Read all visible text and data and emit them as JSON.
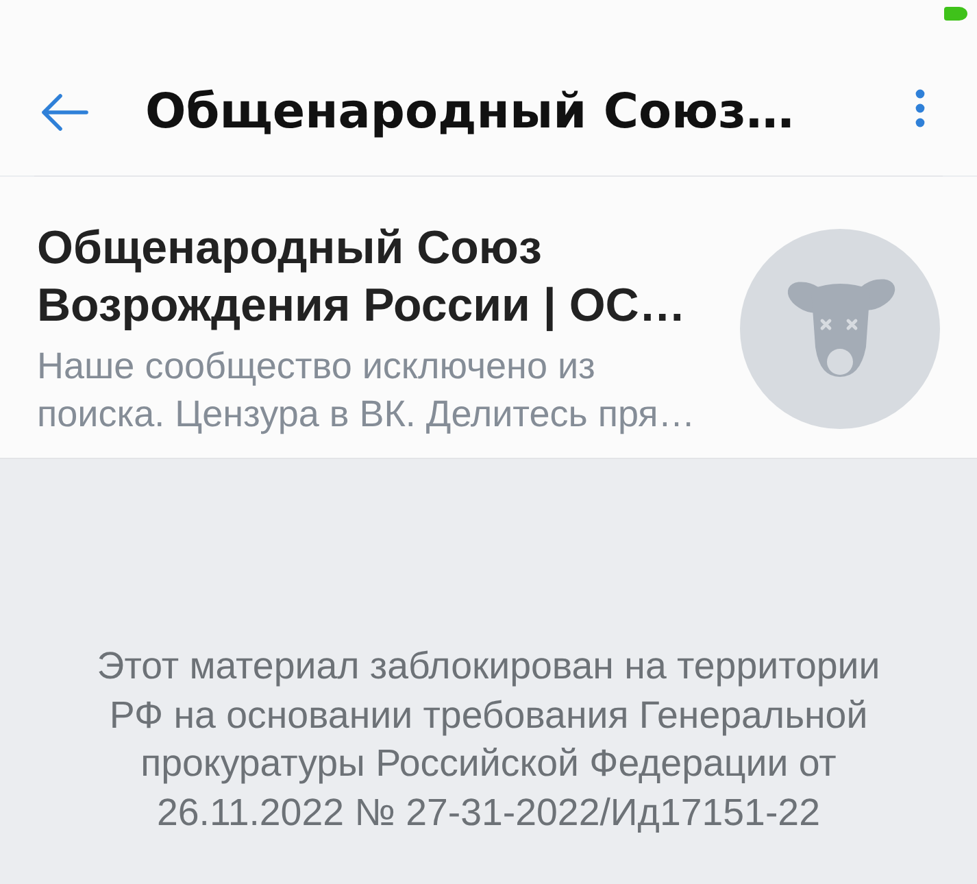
{
  "header": {
    "title": "Общенародный Союз…"
  },
  "group": {
    "name": "Общенародный Союз\nВозрождения России | ОС…",
    "description": "Наше сообщество исключено из\nпоиска. Цензура в ВК. Делитесь пря…"
  },
  "blocked_notice": {
    "text": "Этот материал заблокирован на территории\nРФ на основании требования Генеральной\nпрокуратуры Российской Федерации от\n26.11.2022 № 27-31-2022/Ид17151-22"
  }
}
